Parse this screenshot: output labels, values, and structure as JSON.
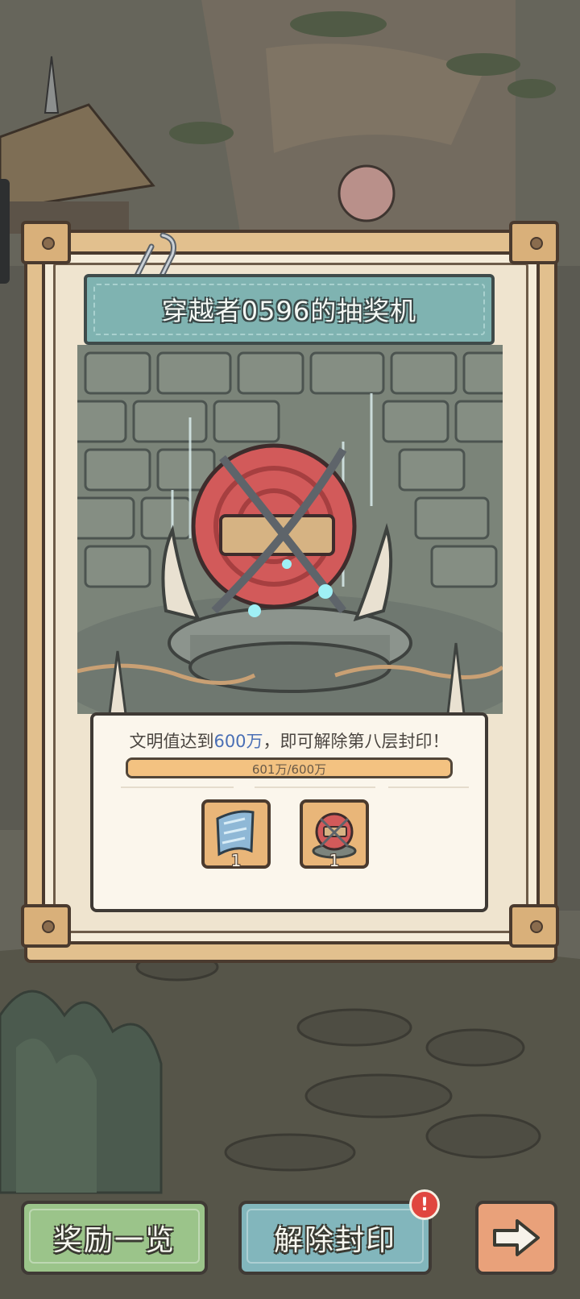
{
  "window": {
    "title": "穿越者0596的抽奖机"
  },
  "seal": {
    "text_prefix": "文明值达到",
    "target_highlight": "600万",
    "text_suffix": "，即可解除第八层封印！",
    "progress_label": "601万/600万",
    "progress_fraction": 1.0
  },
  "rewards": [
    {
      "icon": "blue-blade-icon",
      "count": "1"
    },
    {
      "icon": "sealed-orb-icon",
      "count": "1"
    }
  ],
  "buttons": {
    "rewards_label": "奖励一览",
    "unseal_label": "解除封印",
    "next_icon": "arrow-right-icon",
    "badge": "!"
  },
  "colors": {
    "banner": "#7fb3b1",
    "highlight": "#4a6fb5",
    "progress": "#f3c281",
    "rewards_button": "#9bc48a",
    "unseal_button": "#82b6bc",
    "next_button": "#e9a17a",
    "badge": "#e0463f"
  }
}
